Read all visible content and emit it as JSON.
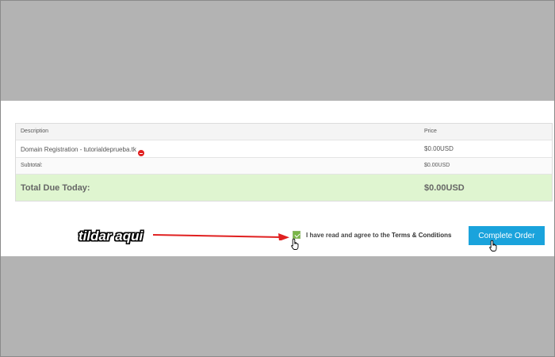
{
  "order_table": {
    "header": {
      "description": "Description",
      "price": "Price"
    },
    "item": {
      "description": "Domain Registration - tutorialdeprueba.tk",
      "price": "$0.00USD",
      "remove_icon": "remove-circle-icon"
    },
    "subtotal": {
      "label": "Subtotal:",
      "value": "$0.00USD"
    },
    "total": {
      "label": "Total Due Today:",
      "value": "$0.00USD"
    },
    "total_bg_color": "#dff5d0"
  },
  "agreement": {
    "prefix": "I have read and agree to the ",
    "link": "Terms & Conditions",
    "checked": true,
    "checkbox_color": "#7ab648"
  },
  "complete_button": {
    "label": "Complete Order",
    "color": "#1aa3dc"
  },
  "annotation": {
    "text": "tildar aqui",
    "arrow_color": "#e02020"
  },
  "icons": {
    "cursor": "hand-pointer-icon",
    "arrow": "red-arrow-icon"
  }
}
